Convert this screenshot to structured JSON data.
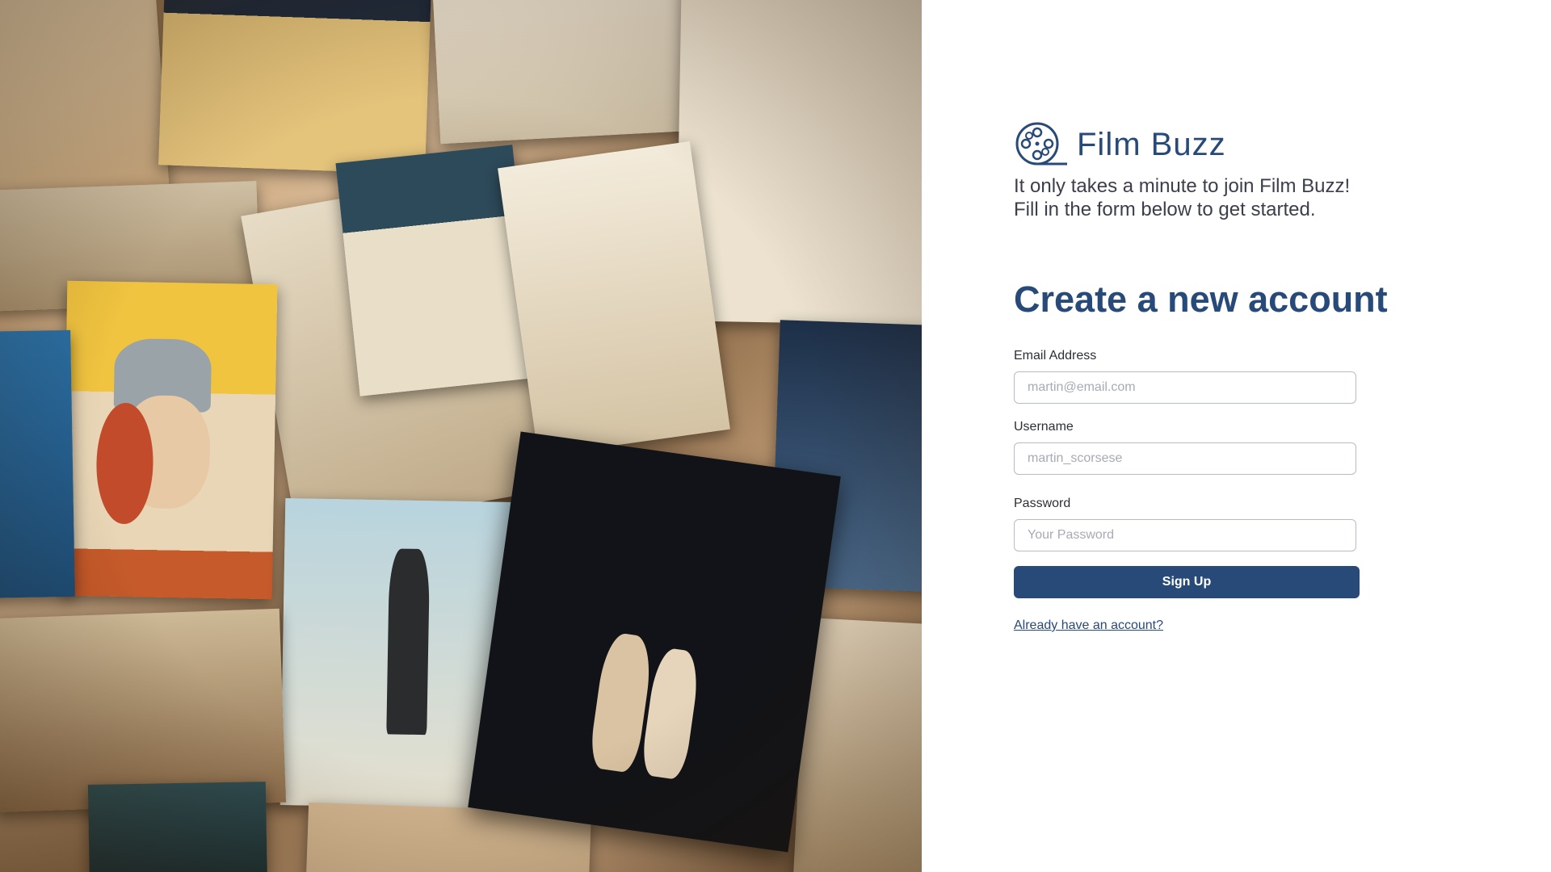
{
  "hero": {
    "image_name": "vintage-movie-poster-collage",
    "colors": {
      "red_type": "#e23b1f",
      "poster_dark": "#111318",
      "poster_gold": "#f0b13b"
    }
  },
  "brand": {
    "icon": "film-reel-icon",
    "name": "Film Buzz",
    "color": "#274a78"
  },
  "intro": {
    "line1": "It only takes a minute to join Film Buzz!",
    "line2": "Fill in the form below to get started."
  },
  "form": {
    "title": "Create a new account",
    "email": {
      "label": "Email Address",
      "placeholder": "martin@email.com",
      "value": ""
    },
    "username": {
      "label": "Username",
      "placeholder": "martin_scorsese",
      "value": ""
    },
    "password": {
      "label": "Password",
      "placeholder": "Your Password",
      "value": ""
    },
    "submit_label": "Sign Up",
    "login_link": "Already have an account?"
  },
  "colors": {
    "accent": "#274a78",
    "text": "#2b2f36",
    "input_border": "#b6bcc6",
    "placeholder": "#a5abb5"
  }
}
